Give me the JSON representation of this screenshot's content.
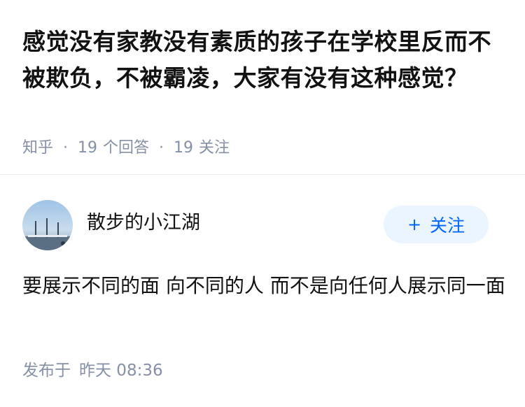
{
  "question": {
    "title": "感觉没有家教没有素质的孩子在学校里反而不被欺负，不被霸凌，大家有没有这种感觉？",
    "source": "知乎",
    "answer_count": "19",
    "answer_label": "个回答",
    "follower_count": "19",
    "follower_label": "关注",
    "separator": "·"
  },
  "answer": {
    "author_name": "散步的小江湖",
    "follow_button": {
      "icon": "+",
      "label": "关注"
    },
    "content": "要展示不同的面 向不同的人 而不是向任何人展示同一面",
    "published_label": "发布于",
    "published_time": "昨天 08:36"
  },
  "colors": {
    "accent": "#0066ff",
    "accent_bg": "#ebf5ff",
    "meta_text": "#8590a6",
    "divider": "#ebebeb"
  }
}
